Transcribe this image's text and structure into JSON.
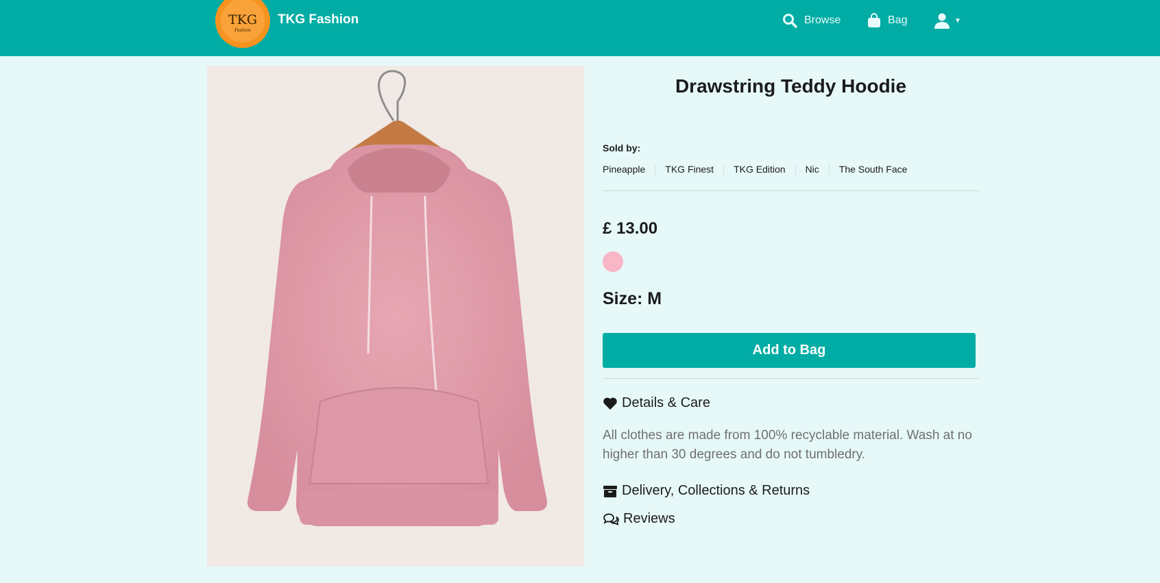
{
  "header": {
    "logo_text": "TKG",
    "logo_subtext": "Fashion",
    "brand": "TKG Fashion",
    "nav": {
      "browse": "Browse",
      "bag": "Bag"
    }
  },
  "product": {
    "title": "Drawstring Teddy Hoodie",
    "sold_by_label": "Sold by:",
    "sellers": [
      "Pineapple",
      "TKG Finest",
      "TKG Edition",
      "Nic",
      "The South Face"
    ],
    "price": "£ 13.00",
    "color_swatch": "#f8b6c6",
    "size": "Size: M",
    "add_to_bag": "Add to Bag",
    "details_heading": "Details & Care",
    "details_text": "All clothes are made from 100% recyclable material. Wash at no higher than 30 degrees and do not tumbledry.",
    "delivery_heading": "Delivery, Collections & Returns",
    "reviews_heading": "Reviews"
  },
  "colors": {
    "accent": "#00aca4",
    "background": "#e6f9f8",
    "logo": "#f7931e"
  },
  "icons": [
    "search-icon",
    "bag-icon",
    "user-icon",
    "heart-icon",
    "box-icon",
    "comments-icon"
  ]
}
